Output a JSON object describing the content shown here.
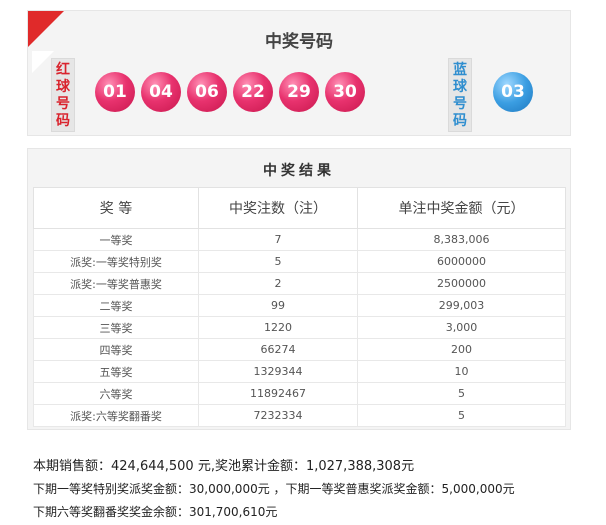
{
  "draw": {
    "title": "中奖号码",
    "red_label": "红球号码",
    "blue_label": "蓝球号码",
    "red_balls": [
      "01",
      "04",
      "06",
      "22",
      "29",
      "30"
    ],
    "blue_ball": "03"
  },
  "colors": {
    "corner": "#e02a2a",
    "red_ball": "#e8326e",
    "blue_ball": "#3b9ee2",
    "red_label_text": "#d9232d",
    "blue_label_text": "#2f8ecf"
  },
  "results": {
    "title": "中奖结果",
    "headers": [
      "奖 等",
      "中奖注数（注）",
      "单注中奖金额（元）"
    ],
    "rows": [
      [
        "一等奖",
        "7",
        "8,383,006"
      ],
      [
        "派奖:一等奖特别奖",
        "5",
        "6000000"
      ],
      [
        "派奖:一等奖普惠奖",
        "2",
        "2500000"
      ],
      [
        "二等奖",
        "99",
        "299,003"
      ],
      [
        "三等奖",
        "1220",
        "3,000"
      ],
      [
        "四等奖",
        "66274",
        "200"
      ],
      [
        "五等奖",
        "1329344",
        "10"
      ],
      [
        "六等奖",
        "11892467",
        "5"
      ],
      [
        "派奖:六等奖翻番奖",
        "7232334",
        "5"
      ]
    ]
  },
  "summary": {
    "line1": "本期销售额：424,644,500 元,奖池累计金额：1,027,388,308元",
    "line2": "下期一等奖特别奖派奖金额：30,000,000元 ，下期一等奖普惠奖派奖金额：5,000,000元",
    "line3": "下期六等奖翻番奖奖金余额：301,700,610元"
  }
}
